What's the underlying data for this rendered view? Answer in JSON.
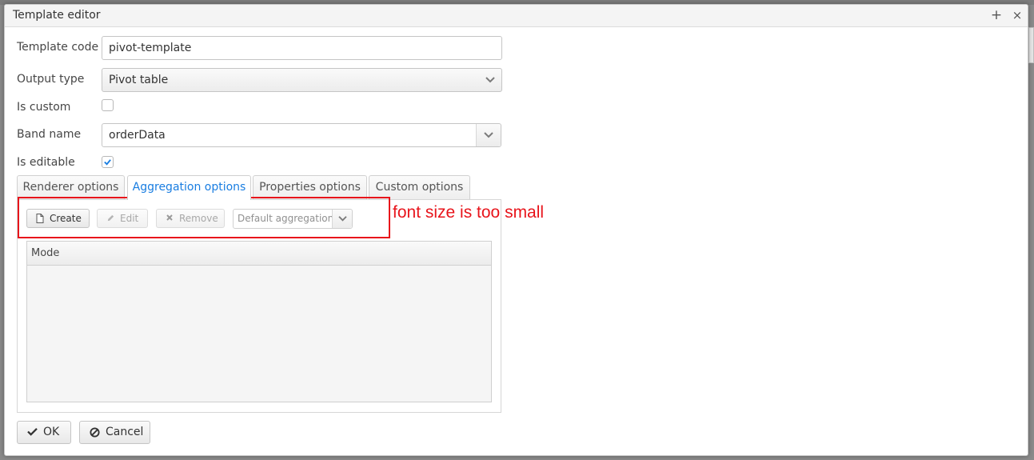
{
  "window": {
    "title": "Template editor"
  },
  "form": {
    "template_code": {
      "label": "Template code",
      "value": "pivot-template"
    },
    "output_type": {
      "label": "Output type",
      "value": "Pivot table"
    },
    "is_custom": {
      "label": "Is custom",
      "checked": false
    },
    "band_name": {
      "label": "Band name",
      "value": "orderData"
    },
    "is_editable": {
      "label": "Is editable",
      "checked": true
    }
  },
  "tabs": [
    {
      "label": "Renderer options",
      "active": false
    },
    {
      "label": "Aggregation options",
      "active": true
    },
    {
      "label": "Properties options",
      "active": false
    },
    {
      "label": "Custom options",
      "active": false
    }
  ],
  "toolbar": {
    "create_label": "Create",
    "edit_label": "Edit",
    "remove_label": "Remove",
    "aggregation_placeholder": "Default aggregation"
  },
  "grid": {
    "columns": [
      "Mode"
    ],
    "rows": []
  },
  "annotation": {
    "text": "font size is too small",
    "color": "#e8141b"
  },
  "footer": {
    "ok_label": "OK",
    "cancel_label": "Cancel"
  },
  "colors": {
    "accent": "#197de1",
    "annotation": "#e8141b"
  }
}
